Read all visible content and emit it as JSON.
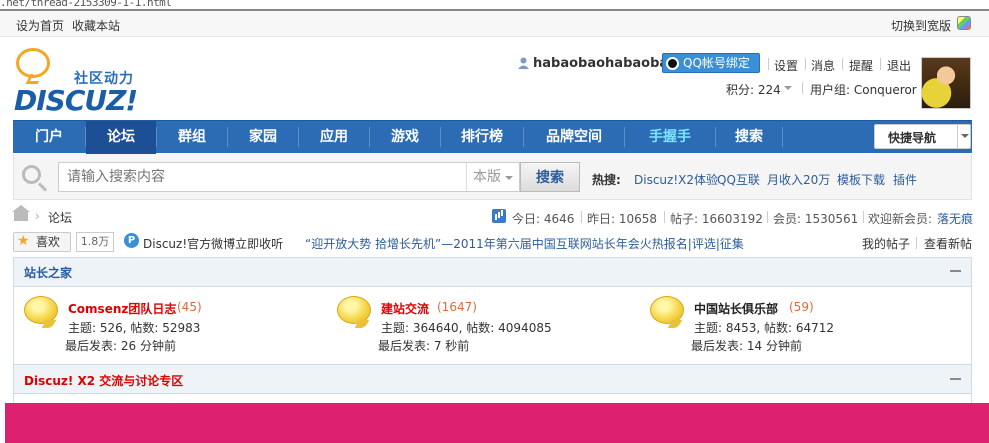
{
  "url_fragment": ".net/thread-2153309-1-1.html",
  "toolbar": {
    "set_home": "设为首页",
    "bookmark": "收藏本站",
    "switch_wide": "切换到宽版"
  },
  "logo": {
    "cn": "社区动力",
    "en": "DISCUZ!"
  },
  "user": {
    "name": "habaobaohabaoba",
    "qq_bind": "QQ帐号绑定",
    "menu": [
      "设置",
      "消息",
      "提醒",
      "退出"
    ],
    "credits_label": "积分: 224",
    "usergroup_label": "用户组: Conqueror"
  },
  "nav": {
    "items": [
      "门户",
      "论坛",
      "群组",
      "家园",
      "应用",
      "游戏",
      "排行榜",
      "品牌空间",
      "手握手",
      "搜索"
    ],
    "active_index": 1,
    "highlight_index": 8,
    "quick_nav": "快捷导航"
  },
  "search": {
    "placeholder": "请输入搜索内容",
    "scope": "本版",
    "button": "搜索",
    "hot_label": "热搜:",
    "hot_links": [
      "Discuz!X2体验",
      "QQ互联",
      "月收入20万",
      "模板下载",
      "插件"
    ]
  },
  "breadcrumb": {
    "current": "论坛"
  },
  "stats": {
    "today": "今日: 4646",
    "yesterday": "昨日: 10658",
    "posts": "帖子: 16603192",
    "members": "会员: 1530561",
    "welcome": "欢迎新会员:",
    "new_member": "落无痕"
  },
  "like": {
    "label": "喜欢",
    "count": "1.8万"
  },
  "weibo": {
    "text": "Discuz!官方微博立即收听"
  },
  "announcement": "“迎开放大势 拾增长先机”—2011年第六届中国互联网站长年会火热报名|评选|征集",
  "right_links": [
    "我的帖子",
    "查看新帖"
  ],
  "sections": [
    {
      "title": "站长之家",
      "forums": [
        {
          "name": "Comsenz团队日志",
          "count": "(45)",
          "topics": "主题: 526, 帖数: 52983",
          "last_post": "最后发表: 26 分钟前",
          "highlight": true
        },
        {
          "name": "建站交流",
          "count": "(1647)",
          "topics": "主题: 364640, 帖数: 4094085",
          "last_post": "最后发表: 7 秒前",
          "highlight": true
        },
        {
          "name": "中国站长俱乐部",
          "count": "(59)",
          "topics": "主题: 8453, 帖数: 64712",
          "last_post": "最后发表: 14 分钟前",
          "highlight": false
        }
      ]
    },
    {
      "title": "Discuz! X2 交流与讨论专区"
    }
  ],
  "colors": {
    "nav_bg": "#2b6cb5",
    "nav_active": "#1c4f93",
    "accent_red": "#e00000",
    "link_blue": "#2b5d9c",
    "bottom_bar": "#dd2070"
  }
}
